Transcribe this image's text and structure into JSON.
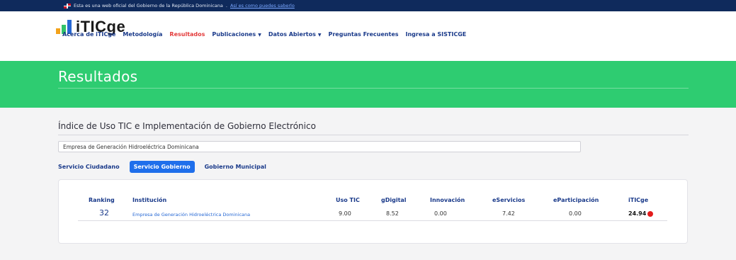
{
  "gov_bar": {
    "notice": "Esta es una web oficial del Gobierno de la República Dominicana",
    "link": "Así es como puedes saberlo"
  },
  "logo": {
    "text": "iTICge"
  },
  "nav": {
    "items": [
      {
        "label": "Acerca de iTICge"
      },
      {
        "label": "Metodología"
      },
      {
        "label": "Resultados"
      },
      {
        "label": "Publicaciones"
      },
      {
        "label": "Datos Abiertos"
      },
      {
        "label": "Preguntas Frecuentes"
      },
      {
        "label": "Ingresa a SISTICGE"
      }
    ],
    "active": "Resultados"
  },
  "banner": {
    "title": "Resultados"
  },
  "section": {
    "title": "Índice de Uso TIC e Implementación de Gobierno Electrónico"
  },
  "institution_input": {
    "value": "Empresa de Generación Hidroeléctrica Dominicana"
  },
  "tabs": [
    {
      "label": "Servicio Ciudadano"
    },
    {
      "label": "Servicio Gobierno"
    },
    {
      "label": "Gobierno Municipal"
    }
  ],
  "active_tab": "Servicio Gobierno",
  "table": {
    "headers": [
      "Ranking",
      "Institución",
      "Uso TIC",
      "gDigital",
      "Innovación",
      "eServicios",
      "eParticipación",
      "iTICge"
    ],
    "row": {
      "ranking": "32",
      "institucion": "Empresa de Generación Hidroeléctrica Dominicana",
      "uso_tic": "9.00",
      "gdigital": "8.52",
      "innovacion": "0.00",
      "eservicios": "7.42",
      "eparticipacion": "0.00",
      "iticge": "24.94"
    },
    "status_color": "#e31b1b"
  },
  "colors": {
    "banner": "#2ecc71",
    "nav_text": "#1a3a8a",
    "nav_active": "#e33b3b",
    "tab_active": "#1f6feb",
    "gov_bar": "#0f2a5c"
  }
}
